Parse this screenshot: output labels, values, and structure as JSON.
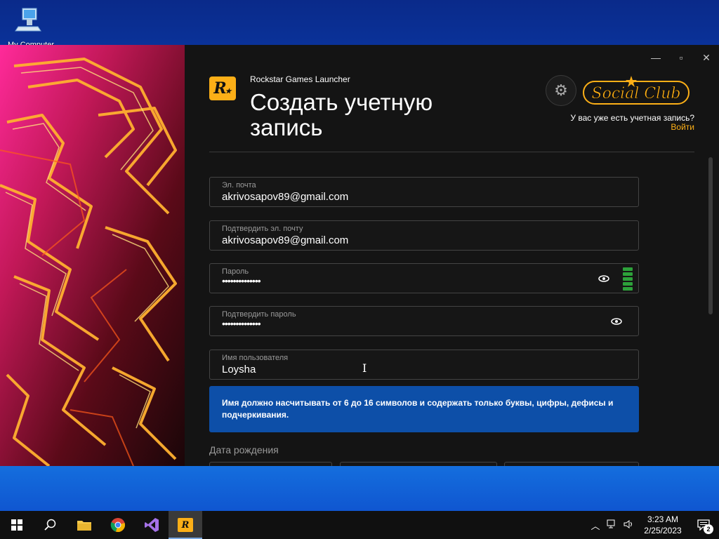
{
  "desktop": {
    "icon_label": "My Computer"
  },
  "window": {
    "app_title": "Rockstar Games Launcher",
    "page_title": "Создать учетную запись",
    "minimize": "—",
    "maximize": "▫",
    "close": "✕",
    "social_club_logo": "Social Club",
    "have_account": "У вас уже есть учетная запись?",
    "login": "Войти"
  },
  "form": {
    "email": {
      "label": "Эл. почта",
      "value": "akrivosapov89@gmail.com"
    },
    "confirm_email": {
      "label": "Подтвердить эл. почту",
      "value": "akrivosapov89@gmail.com"
    },
    "password": {
      "label": "Пароль",
      "value": "••••••••••••••",
      "strength_bars": 5
    },
    "confirm_password": {
      "label": "Подтвердить пароль",
      "value": "••••••••••••••"
    },
    "username": {
      "label": "Имя пользователя",
      "value": "Loysha"
    },
    "username_hint": "Имя должно насчитывать от 6 до 16 символов и содержать только буквы, цифры, дефисы и подчеркивания.",
    "dob_label": "Дата рождения"
  },
  "taskbar": {
    "time": "3:23 AM",
    "date": "2/25/2023",
    "notification_count": "2",
    "apps": [
      "start-icon",
      "search-icon",
      "file-explorer-icon",
      "chrome-icon",
      "visual-studio-icon",
      "rockstar-launcher-icon"
    ]
  },
  "colors": {
    "accent": "#fcaf17",
    "info_box": "#0d4fa8",
    "strength": "#2da13a",
    "window_bg": "#141414"
  }
}
